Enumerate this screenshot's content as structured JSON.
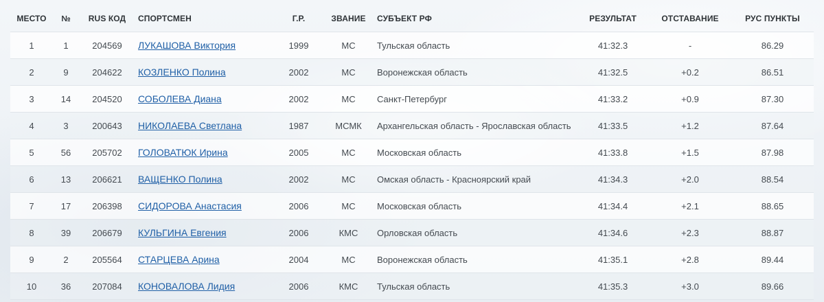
{
  "headers": {
    "place": "МЕСТО",
    "bib": "№",
    "rus_code": "RUS КОД",
    "athlete": "СПОРТСМЕН",
    "birth_year": "Г.Р.",
    "rank": "ЗВАНИЕ",
    "region": "СУБЪЕКТ РФ",
    "result": "РЕЗУЛЬТАТ",
    "behind": "ОТСТАВАНИЕ",
    "points": "РУС ПУНКТЫ"
  },
  "rows": [
    {
      "place": "1",
      "bib": "1",
      "code": "204569",
      "name": "ЛУКАШОВА Виктория",
      "year": "1999",
      "rank": "МС",
      "region": "Тульская область",
      "result": "41:32.3",
      "behind": "-",
      "points": "86.29"
    },
    {
      "place": "2",
      "bib": "9",
      "code": "204622",
      "name": "КОЗЛЕНКО Полина",
      "year": "2002",
      "rank": "МС",
      "region": "Воронежская область",
      "result": "41:32.5",
      "behind": "+0.2",
      "points": "86.51"
    },
    {
      "place": "3",
      "bib": "14",
      "code": "204520",
      "name": "СОБОЛЕВА Диана",
      "year": "2002",
      "rank": "МС",
      "region": "Санкт-Петербург",
      "result": "41:33.2",
      "behind": "+0.9",
      "points": "87.30"
    },
    {
      "place": "4",
      "bib": "3",
      "code": "200643",
      "name": "НИКОЛАЕВА Светлана",
      "year": "1987",
      "rank": "МСМК",
      "region": "Архангельская область - Ярославская область",
      "result": "41:33.5",
      "behind": "+1.2",
      "points": "87.64"
    },
    {
      "place": "5",
      "bib": "56",
      "code": "205702",
      "name": "ГОЛОВАТЮК Ирина",
      "year": "2005",
      "rank": "МС",
      "region": "Московская область",
      "result": "41:33.8",
      "behind": "+1.5",
      "points": "87.98"
    },
    {
      "place": "6",
      "bib": "13",
      "code": "206621",
      "name": "ВАЩЕНКО Полина",
      "year": "2002",
      "rank": "МС",
      "region": "Омская область - Красноярский край",
      "result": "41:34.3",
      "behind": "+2.0",
      "points": "88.54"
    },
    {
      "place": "7",
      "bib": "17",
      "code": "206398",
      "name": "СИДОРОВА Анастасия",
      "year": "2006",
      "rank": "МС",
      "region": "Московская область",
      "result": "41:34.4",
      "behind": "+2.1",
      "points": "88.65"
    },
    {
      "place": "8",
      "bib": "39",
      "code": "206679",
      "name": "КУЛЬГИНА Евгения",
      "year": "2006",
      "rank": "КМС",
      "region": "Орловская область",
      "result": "41:34.6",
      "behind": "+2.3",
      "points": "88.87"
    },
    {
      "place": "9",
      "bib": "2",
      "code": "205564",
      "name": "СТАРЦЕВА Арина",
      "year": "2004",
      "rank": "МС",
      "region": "Воронежская область",
      "result": "41:35.1",
      "behind": "+2.8",
      "points": "89.44"
    },
    {
      "place": "10",
      "bib": "36",
      "code": "207084",
      "name": "КОНОВАЛОВА Лидия",
      "year": "2006",
      "rank": "КМС",
      "region": "Тульская область",
      "result": "41:35.3",
      "behind": "+3.0",
      "points": "89.66"
    }
  ]
}
